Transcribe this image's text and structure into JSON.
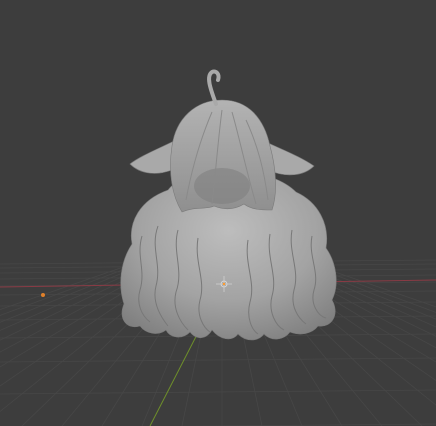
{
  "viewport": {
    "background": "#3d3d3d",
    "grid_color": "#474747",
    "x_axis_color": "#8a3b45",
    "y_axis_color": "#6e8f2a",
    "origin_marker_color": "#e0802a",
    "model_color": "#a6a6a6",
    "model_shade_color": "#6b6b6b",
    "model_highlight_color": "#c9c9c9"
  },
  "objects": {
    "model": "sculpted-hair-mesh",
    "gizmo": "object-origin-gizmo",
    "light": "light-origin-icon"
  }
}
